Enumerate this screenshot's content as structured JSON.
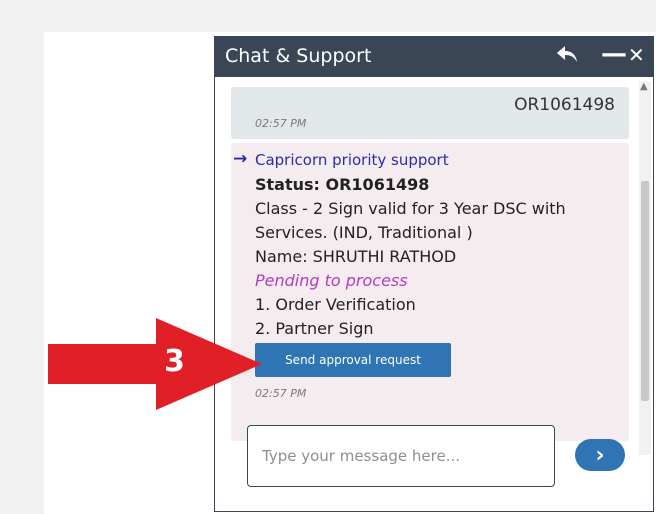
{
  "header": {
    "title": "Chat & Support"
  },
  "messages": {
    "user_message": "OR1061498",
    "user_time": "02:57 PM",
    "bot": {
      "sender": "Capricorn priority support",
      "status": "Status: OR1061498",
      "class_line1": "Class - 2 Sign valid for 3 Year DSC with",
      "class_line2": "Services. (IND, Traditional )",
      "name": "Name: SHRUTHI RATHOD",
      "pending": "Pending to process",
      "step1": "1. Order Verification",
      "step2": "2. Partner Sign",
      "button_label": "Send approval request",
      "time": "02:57 PM"
    }
  },
  "input": {
    "placeholder": "Type your message here..."
  },
  "send_icon": "chevron-right-icon",
  "callout": {
    "number": "3",
    "color": "#e01f26"
  },
  "colors": {
    "header_bg": "#3a4656",
    "accent": "#2f74b3",
    "pending": "#b53cc2"
  }
}
